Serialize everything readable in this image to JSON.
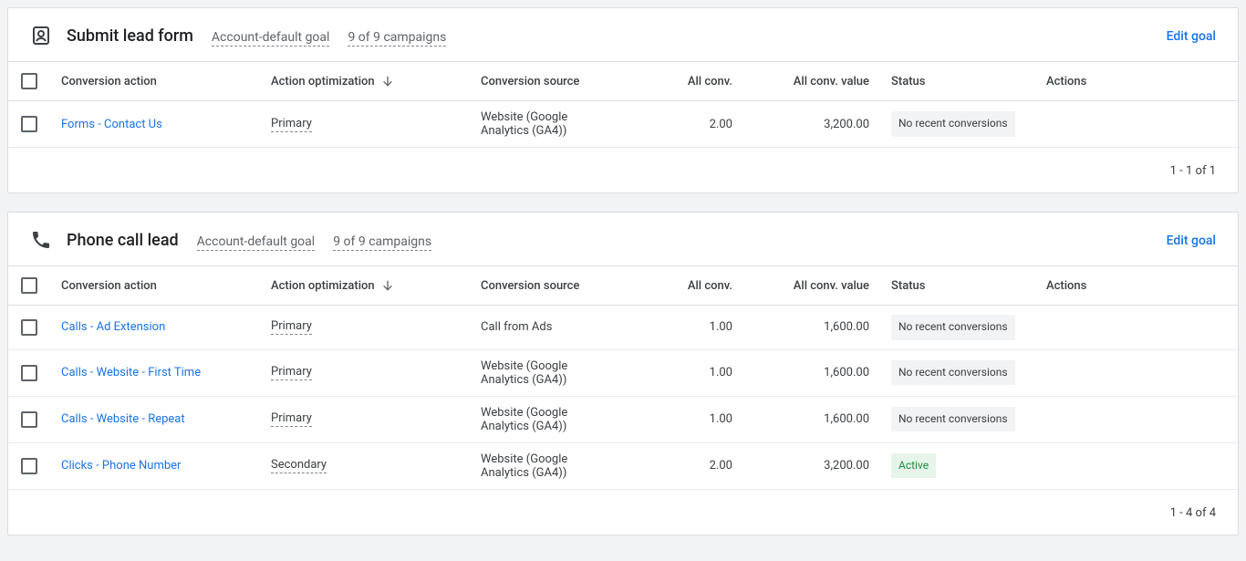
{
  "common": {
    "columns": {
      "conversion_action": "Conversion action",
      "action_optimization": "Action optimization",
      "conversion_source": "Conversion source",
      "all_conv": "All conv.",
      "all_conv_value": "All conv. value",
      "status": "Status",
      "actions": "Actions"
    },
    "edit_goal": "Edit goal"
  },
  "sections": [
    {
      "icon": "lead-form",
      "title": "Submit lead form",
      "goal_meta": "Account-default goal",
      "campaigns_meta": "9 of 9 campaigns",
      "rows": [
        {
          "name": "Forms - Contact Us",
          "optimization": "Primary",
          "source": "Website (Google Analytics (GA4))",
          "all_conv": "2.00",
          "all_conv_value": "3,200.00",
          "status": "No recent conversions",
          "status_kind": "inactive"
        }
      ],
      "pagination": "1 - 1 of 1"
    },
    {
      "icon": "phone",
      "title": "Phone call lead",
      "goal_meta": "Account-default goal",
      "campaigns_meta": "9 of 9 campaigns",
      "rows": [
        {
          "name": "Calls - Ad Extension",
          "optimization": "Primary",
          "source": "Call from Ads",
          "all_conv": "1.00",
          "all_conv_value": "1,600.00",
          "status": "No recent conversions",
          "status_kind": "inactive"
        },
        {
          "name": "Calls - Website - First Time",
          "optimization": "Primary",
          "source": "Website (Google Analytics (GA4))",
          "all_conv": "1.00",
          "all_conv_value": "1,600.00",
          "status": "No recent conversions",
          "status_kind": "inactive"
        },
        {
          "name": "Calls - Website - Repeat",
          "optimization": "Primary",
          "source": "Website (Google Analytics (GA4))",
          "all_conv": "1.00",
          "all_conv_value": "1,600.00",
          "status": "No recent conversions",
          "status_kind": "inactive"
        },
        {
          "name": "Clicks - Phone Number",
          "optimization": "Secondary",
          "source": "Website (Google Analytics (GA4))",
          "all_conv": "2.00",
          "all_conv_value": "3,200.00",
          "status": "Active",
          "status_kind": "active"
        }
      ],
      "pagination": "1 - 4 of 4"
    }
  ]
}
